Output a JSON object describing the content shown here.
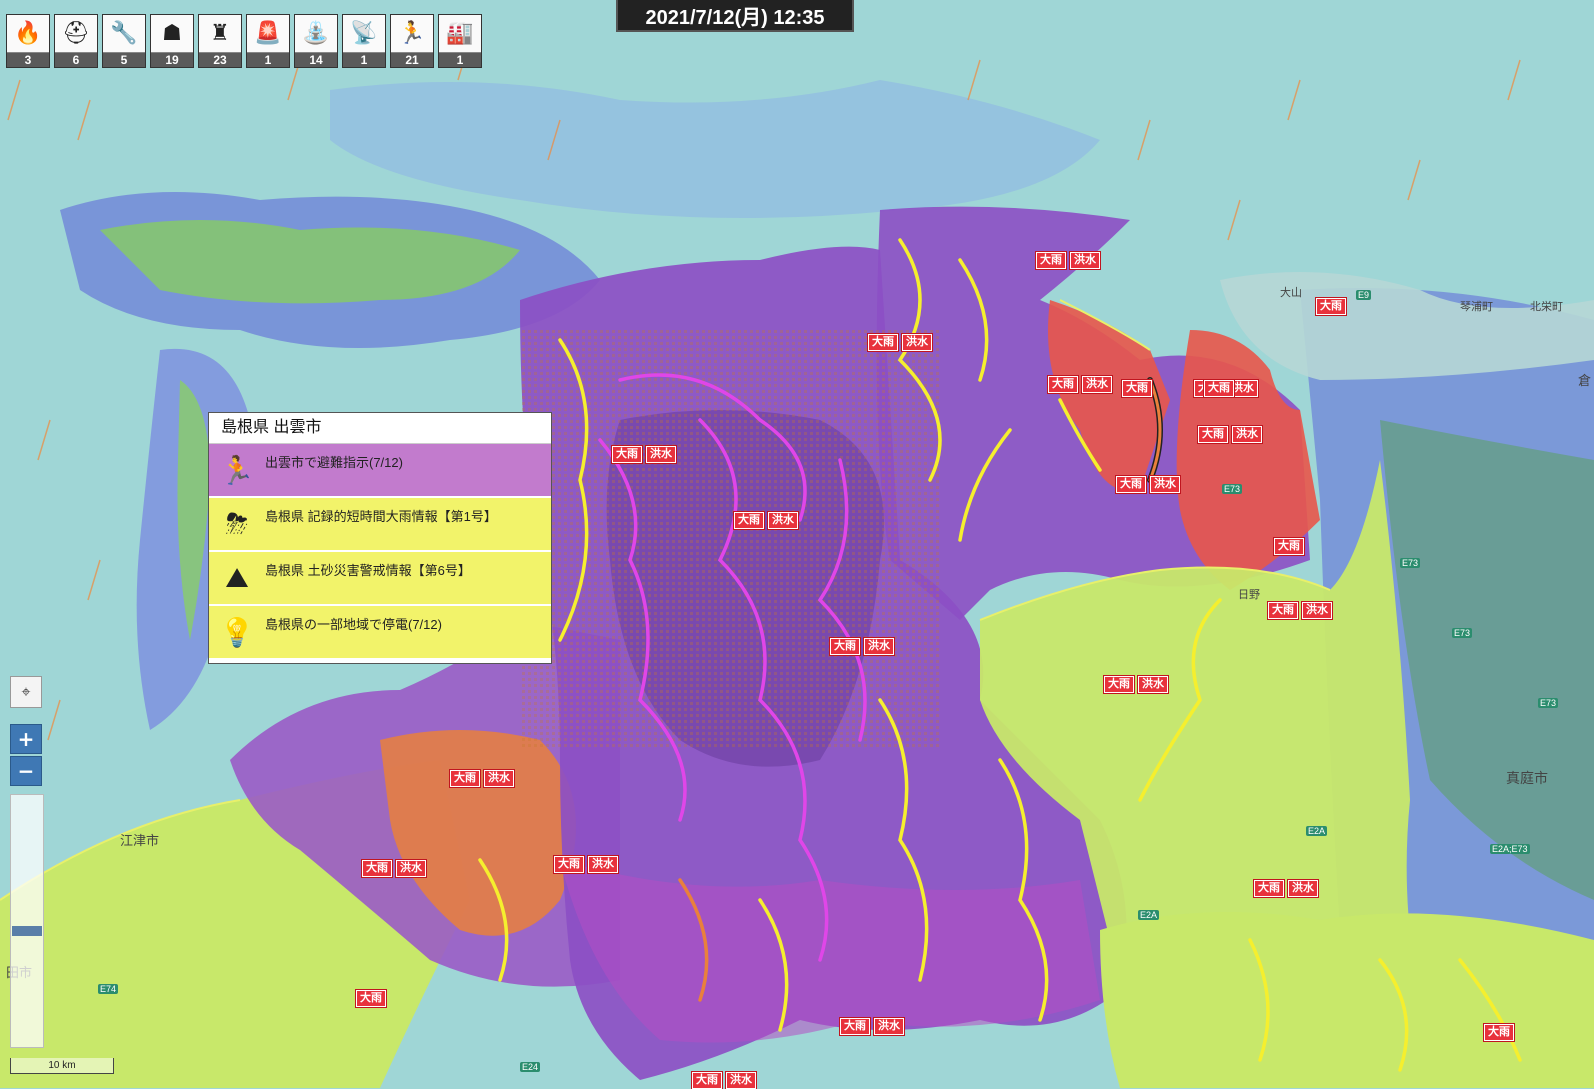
{
  "colors": {
    "sea": "#9fd6d6",
    "rain_blue": "#6f84d8",
    "rain_green": "#86c96a",
    "warn_purple": "#8c4fc4",
    "flood_orange": "#e9803c",
    "alert_red": "#e8574a",
    "low_yellow": "#c8e86a",
    "river_yellow": "#f5ef2e",
    "river_magenta": "#e046e8",
    "popup_purple": "#c27bcd",
    "popup_yellow": "#f2f36a"
  },
  "date_time": "2021/7/12(月)  12:35",
  "categories": [
    {
      "icon": "fire-icon",
      "glyph": "🔥",
      "count": "3"
    },
    {
      "icon": "firefighter-icon",
      "glyph": "⛑",
      "count": "6"
    },
    {
      "icon": "tools-icon",
      "glyph": "🔧",
      "count": "5"
    },
    {
      "icon": "rescue-icon",
      "glyph": "☗",
      "count": "19"
    },
    {
      "icon": "police-icon",
      "glyph": "♜",
      "count": "23"
    },
    {
      "icon": "siren-icon",
      "glyph": "🚨",
      "count": "1"
    },
    {
      "icon": "water-facility-icon",
      "glyph": "⛲",
      "count": "14"
    },
    {
      "icon": "antenna-icon",
      "glyph": "📡",
      "count": "1"
    },
    {
      "icon": "evacuation-icon",
      "glyph": "🏃",
      "count": "21"
    },
    {
      "icon": "factory-icon",
      "glyph": "🏭",
      "count": "1"
    }
  ],
  "popup": {
    "title": "島根県 出雲市",
    "items": [
      {
        "icon": "evacuation-icon",
        "glyph": "🏃",
        "text": "出雲市で避難指示(7/12)",
        "color": "#c27bcd"
      },
      {
        "icon": "heavy-rain-icon",
        "glyph": "⛈",
        "text": "島根県 記録的短時間大雨情報【第1号】",
        "color": "#f2f36a"
      },
      {
        "icon": "landslide-icon",
        "glyph": "⛰",
        "text": "島根県 土砂災害警戒情報【第6号】",
        "color": "#f2f36a"
      },
      {
        "icon": "lightbulb-icon",
        "glyph": "💡",
        "text": "島根県の一部地域で停電(7/12)",
        "color": "#f2f36a"
      }
    ]
  },
  "warning_words": {
    "rain": "大雨",
    "flood": "洪水"
  },
  "warnings": [
    {
      "kind": "both"
    },
    {
      "kind": "both"
    },
    {
      "kind": "rain"
    },
    {
      "kind": "both"
    },
    {
      "kind": "rain"
    },
    {
      "kind": "both"
    },
    {
      "kind": "both"
    },
    {
      "kind": "both"
    },
    {
      "kind": "rain"
    },
    {
      "kind": "both"
    },
    {
      "kind": "both"
    },
    {
      "kind": "both"
    },
    {
      "kind": "both"
    },
    {
      "kind": "both"
    },
    {
      "kind": "both"
    },
    {
      "kind": "both"
    },
    {
      "kind": "both"
    },
    {
      "kind": "both"
    },
    {
      "kind": "rain"
    },
    {
      "kind": "both"
    },
    {
      "kind": "rain"
    },
    {
      "kind": "both"
    },
    {
      "kind": "rain"
    }
  ],
  "places": [
    "江津市",
    "真庭市",
    "琴浦町",
    "北栄町",
    "倉",
    "大山",
    "日野",
    "田市"
  ],
  "roads": [
    "E9",
    "E73",
    "E73",
    "E73",
    "E73",
    "E2A",
    "E2A;E73",
    "E2A",
    "E74",
    "E24"
  ],
  "scale_label": "10 km",
  "zoom": {
    "in": "+",
    "out": "−",
    "locate_icon": "⌖"
  }
}
